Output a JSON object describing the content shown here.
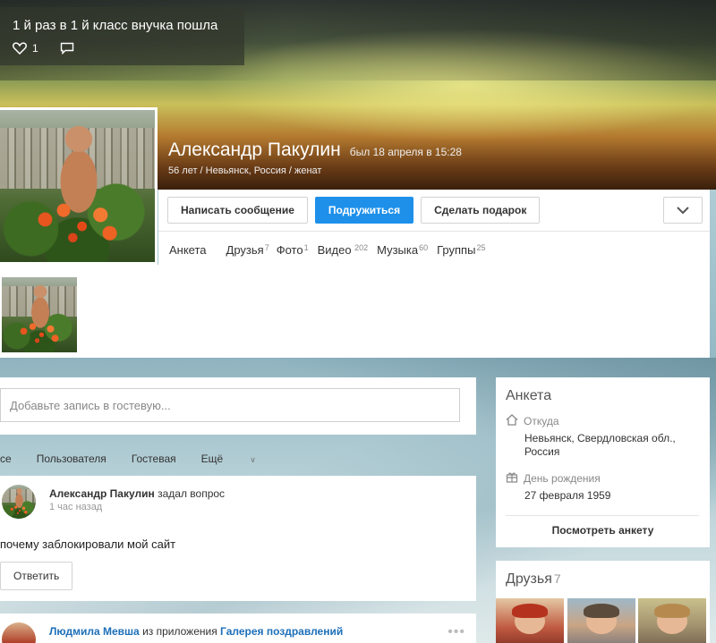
{
  "status": {
    "text": "1 й раз в 1 й класс внучка пошла",
    "likes": "1"
  },
  "profile": {
    "name": "Александр Пакулин",
    "last_seen": "был 18 апреля в 15:28",
    "info": "56 лет / Невьянск, Россия / женат"
  },
  "actions": {
    "message": "Написать сообщение",
    "friend": "Подружиться",
    "gift": "Сделать подарок"
  },
  "tabs": [
    {
      "label": "Анкета",
      "count": ""
    },
    {
      "label": "Друзья",
      "count": "7"
    },
    {
      "label": "Фото",
      "count": "1"
    },
    {
      "label": "Видео",
      "count": " 202"
    },
    {
      "label": "Музыка",
      "count": "60"
    },
    {
      "label": "Группы",
      "count": "25"
    }
  ],
  "guestbook": {
    "placeholder": "Добавьте запись в гостевую..."
  },
  "feed_filters": [
    "се",
    "Пользователя",
    "Гостевая",
    "Ещё"
  ],
  "post1": {
    "author": "Александр Пакулин",
    "action": "задал вопрос",
    "time": "1 час назад",
    "text": "почему заблокировали мой сайт",
    "reply": "Ответить"
  },
  "post2": {
    "author": "Людмила Мевша",
    "from": "из приложения",
    "app": "Галерея поздравлений",
    "time": "...",
    "dots": "•••"
  },
  "anketa": {
    "title": "Анкета",
    "from_label": "Откуда",
    "from_value": "Невьянск, Свердловская обл., Россия",
    "birthday_label": "День рождения",
    "birthday_value": "27 февраля 1959",
    "view_link": "Посмотреть анкету"
  },
  "friends": {
    "title": "Друзья",
    "count": "7"
  },
  "colors": {
    "primary_button": "#1e90ea",
    "link": "#1d6fb8"
  }
}
